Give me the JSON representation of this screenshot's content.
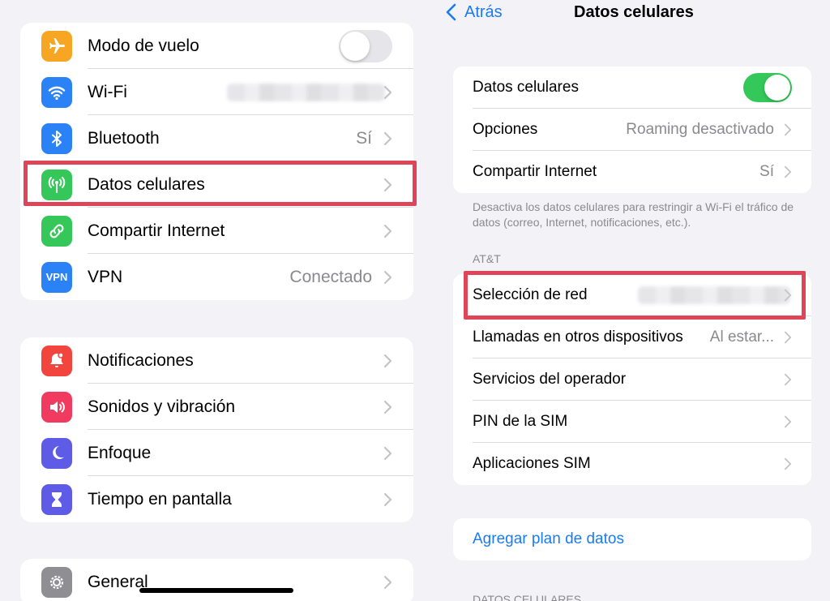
{
  "left": {
    "group1": [
      {
        "label": "Modo de vuelo",
        "icon": "airplane-icon",
        "color": "#f6a623",
        "toggle": "off"
      },
      {
        "label": "Wi-Fi",
        "icon": "wifi-icon",
        "color": "#2a82f6",
        "value": ""
      },
      {
        "label": "Bluetooth",
        "icon": "bluetooth-icon",
        "color": "#2a82f6",
        "value": "Sí"
      },
      {
        "label": "Datos celulares",
        "icon": "antenna-icon",
        "color": "#35c759",
        "value": ""
      },
      {
        "label": "Compartir Internet",
        "icon": "link-icon",
        "color": "#35c759",
        "value": ""
      },
      {
        "label": "VPN",
        "icon": "vpn-icon",
        "color": "#2a82f6",
        "value": "Conectado",
        "icon_text": "VPN"
      }
    ],
    "group2": [
      {
        "label": "Notificaciones",
        "icon": "bell-icon",
        "color": "#f2453d"
      },
      {
        "label": "Sonidos y vibración",
        "icon": "speaker-icon",
        "color": "#f03a5f"
      },
      {
        "label": "Enfoque",
        "icon": "moon-icon",
        "color": "#5e5ce6"
      },
      {
        "label": "Tiempo en pantalla",
        "icon": "hourglass-icon",
        "color": "#5e5ce6"
      }
    ],
    "group3": [
      {
        "label": "General",
        "icon": "gear-icon",
        "color": "#8e8e93"
      }
    ]
  },
  "right": {
    "nav": {
      "back_label": "Atrás",
      "title": "Datos celulares"
    },
    "group1": [
      {
        "label": "Datos celulares",
        "toggle": "on"
      },
      {
        "label": "Opciones",
        "value": "Roaming desactivado"
      },
      {
        "label": "Compartir Internet",
        "value": "Sí"
      }
    ],
    "footnote": "Desactiva los datos celulares para restringir a Wi-Fi el tráfico de datos (correo, Internet, notificaciones, etc.).",
    "section_carrier": "AT&T",
    "group2": [
      {
        "label": "Selección de red",
        "value": ""
      },
      {
        "label": "Llamadas en otros dispositivos",
        "value": "Al estar..."
      },
      {
        "label": "Servicios del operador",
        "value": ""
      },
      {
        "label": "PIN de la SIM",
        "value": ""
      },
      {
        "label": "Aplicaciones SIM",
        "value": ""
      }
    ],
    "add_plan": "Agregar plan de datos",
    "section_data": "DATOS CELULARES"
  },
  "colors": {
    "highlight": "#e04458",
    "accent": "#1a7bf2",
    "toggle_on": "#34c759"
  }
}
